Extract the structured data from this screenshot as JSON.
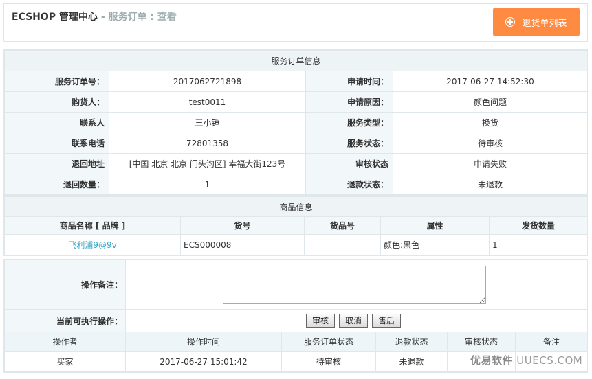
{
  "header": {
    "app_title": "ECSHOP 管理中心",
    "sub_title": "- 服务订单 : 查看",
    "back_button_label": "退货单列表",
    "back_button_color": "#ff8b43"
  },
  "service_info": {
    "caption": "服务订单信息",
    "rows": [
      {
        "l1": "服务订单号：",
        "v1": "2017062721898",
        "l2": "申请时间：",
        "v2": "2017-06-27 14:52:30"
      },
      {
        "l1": "购货人：",
        "v1": "test0011",
        "l2": "申请原因：",
        "v2": "颜色问题"
      },
      {
        "l1": "联系人",
        "v1": "王小锤",
        "l2": "服务类型：",
        "v2": "换货"
      },
      {
        "l1": "联系电话",
        "v1": "72801358",
        "l2": "服务状态：",
        "v2": "待审核"
      },
      {
        "l1": "退回地址",
        "v1": "[中国 北京 北京 门头沟区] 幸福大街123号",
        "l2": "审核状态",
        "v2": "申请失败"
      },
      {
        "l1": "退回数量：",
        "v1": "1",
        "l2": "退款状态：",
        "v2": "未退款"
      }
    ]
  },
  "goods_info": {
    "caption": "商品信息",
    "headers": [
      "商品名称 [ 品牌 ]",
      "货号",
      "货品号",
      "属性",
      "发货数量"
    ],
    "rows": [
      {
        "name": "飞利浦9@9v",
        "sn": "ECS000008",
        "product_sn": "",
        "attr": "颜色:黑色",
        "qty": "1"
      }
    ]
  },
  "operation": {
    "remark_label": "操作备注：",
    "remark_value": "",
    "ops_label": "当前可执行操作：",
    "buttons": {
      "audit": "审核",
      "cancel": "取消",
      "after_sale": "售后"
    },
    "log_headers": [
      "操作者",
      "操作时间",
      "服务订单状态",
      "退款状态",
      "审核状态",
      "备注"
    ],
    "log_rows": [
      {
        "operator": "买家",
        "time": "2017-06-27 15:01:42",
        "status": "待审核",
        "refund": "未退款",
        "audit": "",
        "note": ""
      }
    ]
  },
  "watermark": {
    "brand": "优易软件",
    "domain": "UUECS.COM"
  }
}
